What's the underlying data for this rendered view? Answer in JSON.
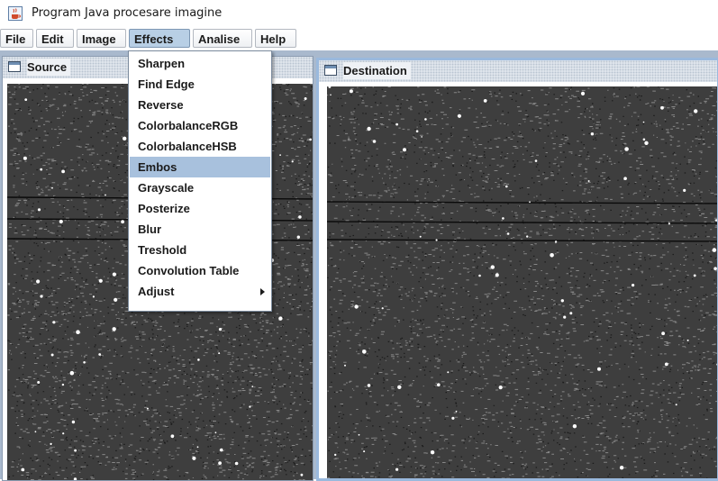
{
  "window": {
    "title": "Program Java procesare imagine",
    "icon": "java-cup-icon"
  },
  "menubar": {
    "items": [
      {
        "label": "File"
      },
      {
        "label": "Edit"
      },
      {
        "label": "Image"
      },
      {
        "label": "Effects",
        "active": true
      },
      {
        "label": "Analise"
      },
      {
        "label": "Help"
      }
    ]
  },
  "frames": {
    "source": {
      "title": "Source",
      "icon": "window-icon"
    },
    "destination": {
      "title": "Destination",
      "icon": "window-icon",
      "active": true
    }
  },
  "effects_menu": {
    "items": [
      {
        "label": "Sharpen"
      },
      {
        "label": "Find Edge"
      },
      {
        "label": "Reverse"
      },
      {
        "label": "ColorbalanceRGB"
      },
      {
        "label": "ColorbalanceHSB"
      },
      {
        "label": "Embos",
        "selected": true
      },
      {
        "label": "Grayscale"
      },
      {
        "label": "Posterize"
      },
      {
        "label": "Blur"
      },
      {
        "label": "Treshold"
      },
      {
        "label": "Convolution Table"
      },
      {
        "label": "Adjust",
        "submenu": true,
        "submenu_icon": "chevron-right-icon"
      }
    ]
  },
  "colors": {
    "desktop": "#a9b9cd",
    "menu_selected": "#a8c1dd",
    "image_background": "#3e3e3e"
  }
}
